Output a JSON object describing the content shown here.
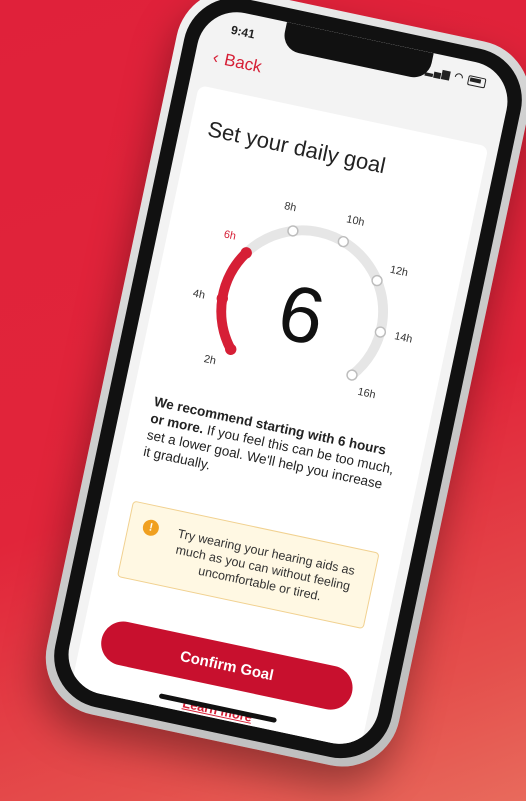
{
  "status": {
    "time": "9:41"
  },
  "nav": {
    "back_label": "Back"
  },
  "page": {
    "title": "Set your daily goal"
  },
  "dial": {
    "value": "6",
    "selected_hours": 6,
    "labels": [
      "2h",
      "4h",
      "6h",
      "8h",
      "10h",
      "12h",
      "14h",
      "16h"
    ],
    "accent": "#d61f36",
    "inactive": "#e6e6e6"
  },
  "message": {
    "bold": "We recommend starting with 6 hours or more.",
    "text": " If you feel this can be too much, set a lower goal. We'll help you increase it gradually."
  },
  "tip": {
    "icon": "info-icon",
    "text": "Try wearing your hearing aids as much as you can without feeling uncomfortable or tired."
  },
  "actions": {
    "confirm_label": "Confirm Goal",
    "learn_more_label": "Learn more"
  }
}
